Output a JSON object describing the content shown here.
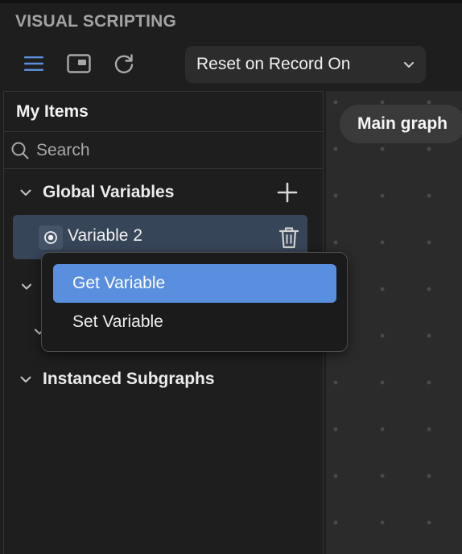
{
  "panel": {
    "title": "VISUAL SCRIPTING"
  },
  "toolbar": {
    "icons": [
      "list-icon",
      "picture-in-picture-icon",
      "refresh-icon"
    ],
    "accent_color": "#5b8fdd",
    "dropdown": {
      "selected": "Reset on Record On",
      "icon": "chevron-down-icon"
    }
  },
  "sidebar": {
    "heading": "My Items",
    "search": {
      "placeholder": "Search",
      "value": ""
    },
    "groups": [
      {
        "label": "Global Variables",
        "expanded": true,
        "items": [
          {
            "label": "Variable 2",
            "icon": "radio-icon",
            "selected": true
          }
        ]
      },
      {
        "label": "Instanced Subgraphs",
        "expanded": true,
        "items": []
      }
    ]
  },
  "canvas": {
    "tab_label": "Main graph"
  },
  "context_menu": {
    "items": [
      {
        "label": "Get Variable",
        "highlighted": true
      },
      {
        "label": "Set Variable",
        "highlighted": false
      }
    ],
    "highlight_color": "#5a8fe0"
  }
}
